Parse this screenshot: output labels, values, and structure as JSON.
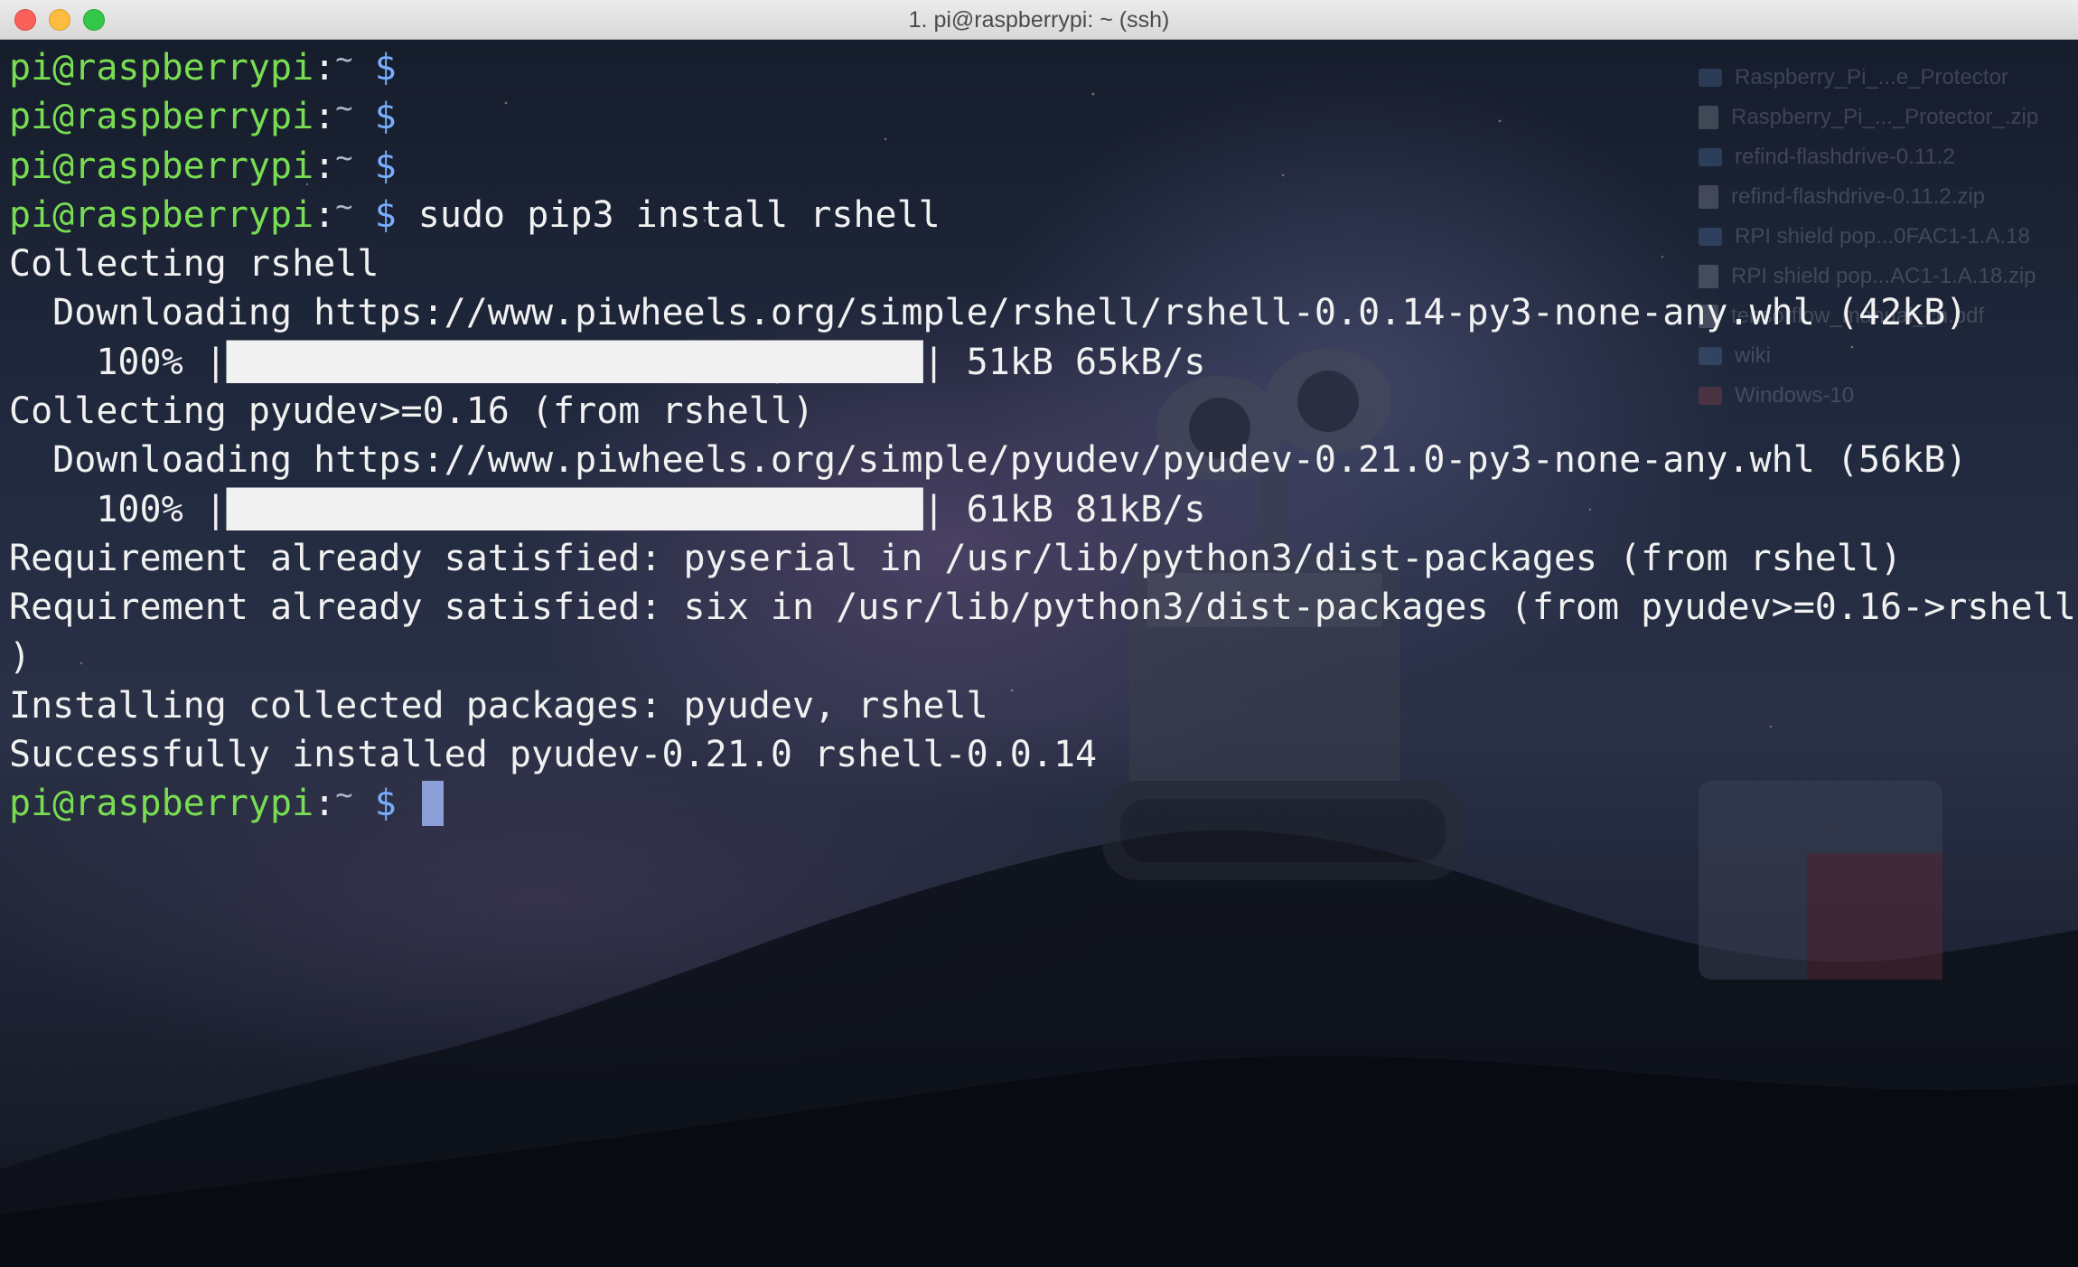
{
  "window": {
    "title": "1. pi@raspberrypi: ~ (ssh)"
  },
  "colors": {
    "prompt_user": "#79dd52",
    "prompt_dollar": "#78aefb",
    "text": "#f1f1f1",
    "cursor": "#8c9fd9"
  },
  "prompt": {
    "user_host": "pi@raspberrypi",
    "colon": ":",
    "tilde": "~",
    "dollar": "$"
  },
  "lines": [
    {
      "type": "prompt",
      "command": ""
    },
    {
      "type": "prompt",
      "command": ""
    },
    {
      "type": "prompt",
      "command": ""
    },
    {
      "type": "prompt",
      "command": "sudo pip3 install rshell"
    },
    {
      "type": "output",
      "text": "Collecting rshell"
    },
    {
      "type": "output",
      "text": "  Downloading https://www.piwheels.org/simple/rshell/rshell-0.0.14-py3-none-any.whl (42kB)"
    },
    {
      "type": "output",
      "text": "    100% |████████████████████████████████| 51kB 65kB/s"
    },
    {
      "type": "output",
      "text": "Collecting pyudev>=0.16 (from rshell)"
    },
    {
      "type": "output",
      "text": "  Downloading https://www.piwheels.org/simple/pyudev/pyudev-0.21.0-py3-none-any.whl (56kB)"
    },
    {
      "type": "output",
      "text": "    100% |████████████████████████████████| 61kB 81kB/s"
    },
    {
      "type": "output",
      "text": "Requirement already satisfied: pyserial in /usr/lib/python3/dist-packages (from rshell)"
    },
    {
      "type": "output",
      "text": "Requirement already satisfied: six in /usr/lib/python3/dist-packages (from pyudev>=0.16->rshell"
    },
    {
      "type": "output",
      "text": ")"
    },
    {
      "type": "output",
      "text": "Installing collected packages: pyudev, rshell"
    },
    {
      "type": "output",
      "text": "Successfully installed pyudev-0.21.0 rshell-0.0.14"
    },
    {
      "type": "prompt",
      "command": "",
      "cursor": true
    }
  ],
  "desktop_files": [
    {
      "name": "Raspberry_Pi_...e_Protector",
      "icon": "folder-icon"
    },
    {
      "name": "Raspberry_Pi_..._Protector_.zip",
      "icon": "document-icon"
    },
    {
      "name": "refind-flashdrive-0.11.2",
      "icon": "folder-icon"
    },
    {
      "name": "refind-flashdrive-0.11.2.zip",
      "icon": "document-icon"
    },
    {
      "name": "RPI shield pop...0FAC1-1.A.18",
      "icon": "folder-icon"
    },
    {
      "name": "RPI shield pop...AC1-1.A.18.zip",
      "icon": "document-icon"
    },
    {
      "name": "tensorflow_manual_cn.pdf",
      "icon": "document-icon"
    },
    {
      "name": "wiki",
      "icon": "folder-icon"
    },
    {
      "name": "Windows-10",
      "icon": "folder-icon"
    }
  ]
}
